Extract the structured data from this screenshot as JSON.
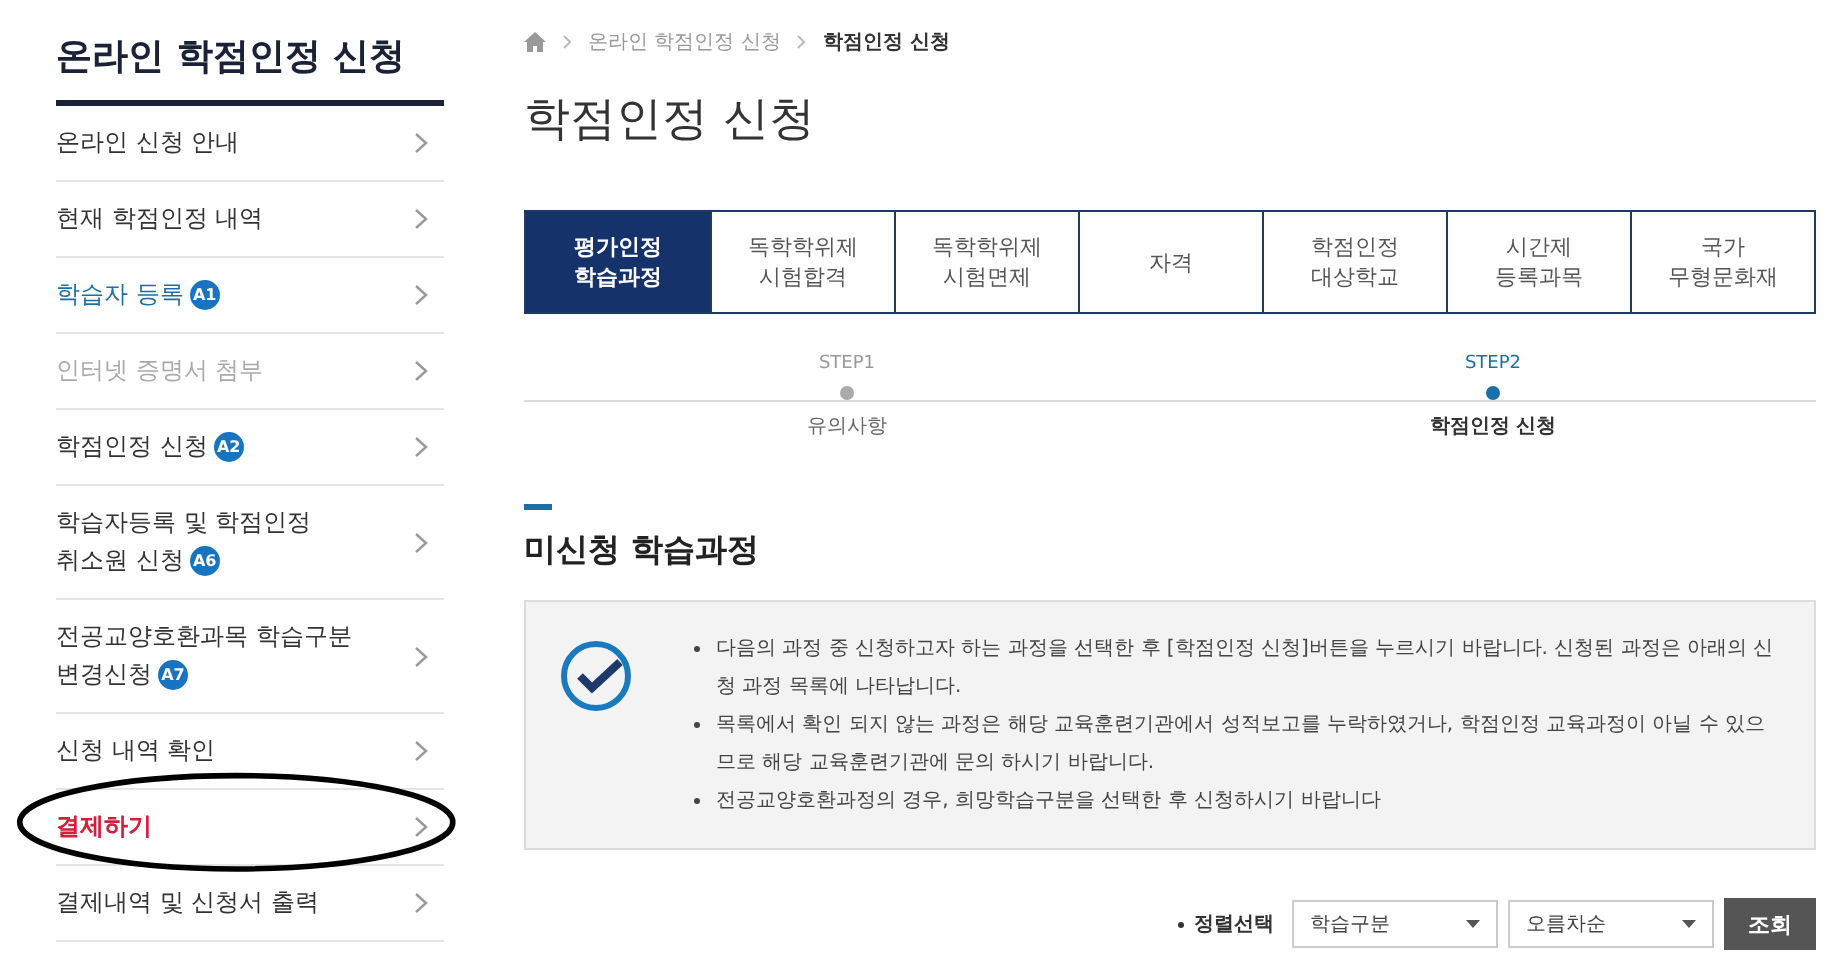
{
  "sidebar": {
    "title": "온라인 학점인정 신청",
    "items": [
      {
        "label": "온라인 신청 안내",
        "kind": "normal"
      },
      {
        "label": "현재 학점인정 내역",
        "kind": "normal"
      },
      {
        "label": "학습자 등록",
        "badge": "A1",
        "kind": "active"
      },
      {
        "label": "인터넷 증명서 첨부",
        "kind": "disabled"
      },
      {
        "label": "학점인정 신청",
        "badge": "A2",
        "kind": "normal"
      },
      {
        "label": "학습자등록 및 학점인정\n취소원 신청",
        "badge": "A6",
        "kind": "normal"
      },
      {
        "label": "전공교양호환과목 학습구분\n변경신청",
        "badge": "A7",
        "kind": "normal"
      },
      {
        "label": "신청 내역 확인",
        "kind": "normal"
      },
      {
        "label": "결제하기",
        "kind": "alert"
      },
      {
        "label": "결제내역 및 신청서 출력",
        "kind": "normal"
      }
    ]
  },
  "breadcrumb": [
    "온라인 학점인정 신청",
    "학점인정 신청"
  ],
  "page_title": "학점인정 신청",
  "tabs": [
    {
      "label": "평가인정\n학습과정",
      "selected": true
    },
    {
      "label": "독학학위제\n시험합격",
      "selected": false
    },
    {
      "label": "독학학위제\n시험면제",
      "selected": false
    },
    {
      "label": "자격",
      "selected": false
    },
    {
      "label": "학점인정\n대상학교",
      "selected": false
    },
    {
      "label": "시간제\n등록과목",
      "selected": false
    },
    {
      "label": "국가\n무형문화재",
      "selected": false
    }
  ],
  "steps": [
    {
      "step": "STEP1",
      "label": "유의사항",
      "selected": false
    },
    {
      "step": "STEP2",
      "label": "학점인정 신청",
      "selected": true
    }
  ],
  "section_title": "미신청 학습과정",
  "notices": [
    "다음의 과정 중 신청하고자 하는 과정을 선택한 후 [학점인정 신청]버튼을 누르시기 바랍니다. 신청된 과정은 아래의 신청 과정 목록에 나타납니다.",
    "목록에서 확인 되지 않는 과정은 해당 교육훈련기관에서 성적보고를 누락하였거나, 학점인정 교육과정이 아닐 수 있으므로 해당 교육훈련기관에 문의 하시기 바랍니다.",
    "전공교양호환과정의 경우, 희망학습구분을 선택한 후 신청하시기 바랍니다"
  ],
  "sort": {
    "label": "정렬선택",
    "selects": [
      "학습구분",
      "오름차순"
    ],
    "button": "조회"
  }
}
